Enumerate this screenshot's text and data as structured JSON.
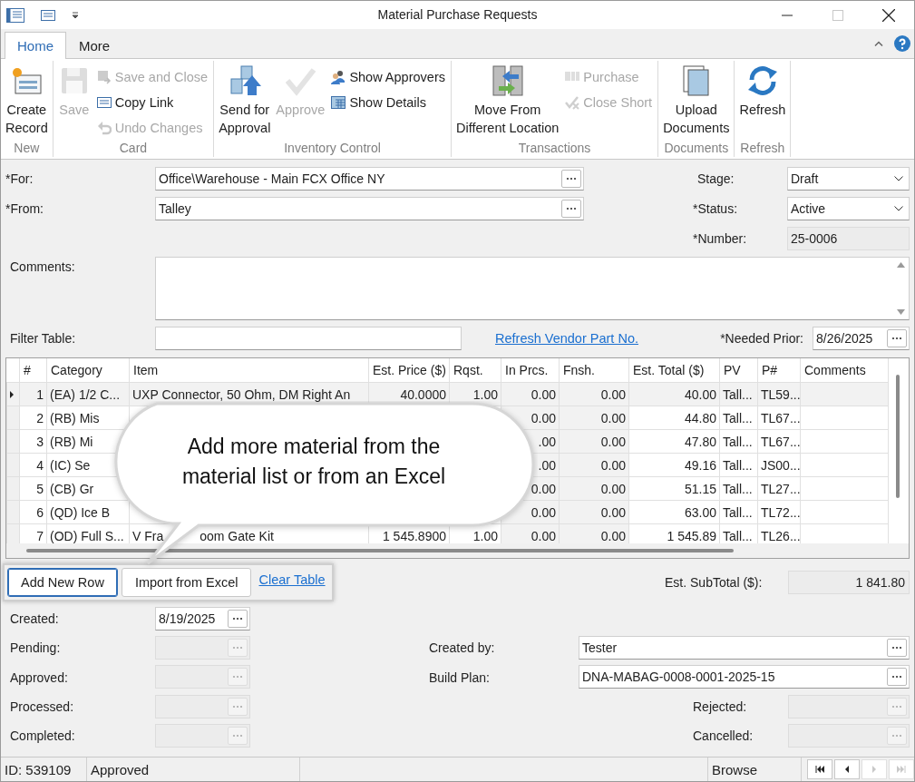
{
  "window": {
    "title": "Material Purchase Requests"
  },
  "tabs": [
    {
      "label": "Home",
      "selected": true
    },
    {
      "label": "More",
      "selected": false
    }
  ],
  "ribbon": [
    {
      "label": "New",
      "large": [
        {
          "kind": "create",
          "label": "Create\nRecord",
          "disabled": false
        }
      ]
    },
    {
      "label": "Card",
      "large": [
        {
          "kind": "save",
          "label": "Save",
          "disabled": true
        }
      ],
      "small": [
        {
          "kind": "saveclose",
          "label": "Save and Close",
          "disabled": true
        },
        {
          "kind": "copylink",
          "label": "Copy Link",
          "disabled": false
        },
        {
          "kind": "undo",
          "label": "Undo Changes",
          "disabled": true
        }
      ]
    },
    {
      "label": "Inventory Control",
      "large": [
        {
          "kind": "send",
          "label": "Send for\nApproval",
          "disabled": false
        },
        {
          "kind": "approve",
          "label": "Approve",
          "disabled": true
        }
      ],
      "small": [
        {
          "kind": "approvers",
          "label": "Show Approvers",
          "disabled": false
        },
        {
          "kind": "details",
          "label": "Show Details",
          "disabled": false
        }
      ]
    },
    {
      "label": "Transactions",
      "large": [
        {
          "kind": "move",
          "label": "Move From\nDifferent Location",
          "disabled": false
        }
      ],
      "small": [
        {
          "kind": "purchase",
          "label": "Purchase",
          "disabled": true
        },
        {
          "kind": "closeshort",
          "label": "Close Short",
          "disabled": true
        }
      ]
    },
    {
      "label": "Documents",
      "large": [
        {
          "kind": "upload",
          "label": "Upload\nDocuments",
          "disabled": false
        }
      ]
    },
    {
      "label": "Refresh",
      "large": [
        {
          "kind": "refresh",
          "label": "Refresh",
          "disabled": false
        }
      ]
    }
  ],
  "form": {
    "for": {
      "label": "*For:",
      "value": "Office\\Warehouse - Main FCX Office NY"
    },
    "from": {
      "label": "*From:",
      "value": "Talley"
    },
    "stage": {
      "label": "Stage:",
      "value": "Draft"
    },
    "status": {
      "label": "*Status:",
      "value": "Active"
    },
    "number": {
      "label": "*Number:",
      "value": "25-0006"
    },
    "comments": {
      "label": "Comments:"
    },
    "filter": {
      "label": "Filter Table:"
    },
    "refresh_link": "Refresh Vendor Part No.",
    "needed_prior": {
      "label": "*Needed Prior:",
      "value": "8/26/2025"
    }
  },
  "table": {
    "columns": [
      {
        "label": "#",
        "kind": "number",
        "readonly": false
      },
      {
        "label": "Category",
        "kind": "text",
        "readonly": false
      },
      {
        "label": "Item",
        "kind": "text",
        "readonly": false
      },
      {
        "label": "Est. Price ($)",
        "kind": "number",
        "readonly": false
      },
      {
        "label": "Rqst.",
        "kind": "number",
        "readonly": false
      },
      {
        "label": "In Prcs.",
        "kind": "number",
        "readonly": true
      },
      {
        "label": "Fnsh.",
        "kind": "number",
        "readonly": true
      },
      {
        "label": "Est. Total ($)",
        "kind": "number",
        "readonly": false
      },
      {
        "label": "PV",
        "kind": "text",
        "readonly": false
      },
      {
        "label": "P#",
        "kind": "text",
        "readonly": false
      },
      {
        "label": "Comments",
        "kind": "text",
        "readonly": false
      }
    ],
    "rows": [
      {
        "selected": true,
        "cells": [
          "1",
          "(EA) 1/2 C...",
          "UXP Connector, 50 Ohm, DM Right An",
          "40.0000",
          "1.00",
          "0.00",
          "0.00",
          "40.00",
          "Tall...",
          "TL59..."
        ]
      },
      {
        "selected": false,
        "cells": [
          "2",
          "(RB) Mis",
          null,
          null,
          null,
          "0.00",
          "0.00",
          "44.80",
          "Tall...",
          "TL67..."
        ]
      },
      {
        "selected": false,
        "cells": [
          "3",
          "(RB) Mi",
          null,
          null,
          null,
          ".00",
          "0.00",
          "47.80",
          "Tall...",
          "TL67..."
        ]
      },
      {
        "selected": false,
        "cells": [
          "4",
          "(IC) Se",
          null,
          null,
          null,
          ".00",
          "0.00",
          "49.16",
          "Tall...",
          "JS00..."
        ]
      },
      {
        "selected": false,
        "cells": [
          "5",
          "(CB) Gr",
          null,
          null,
          null,
          "0.00",
          "0.00",
          "51.15",
          "Tall...",
          "TL27..."
        ]
      },
      {
        "selected": false,
        "cells": [
          "6",
          "(QD) Ice B",
          null,
          null,
          null,
          "0.00",
          "0.00",
          "63.00",
          "Tall...",
          "TL72..."
        ]
      },
      {
        "selected": false,
        "cells": [
          "7",
          "(OD) Full S...",
          [
            "V Fra",
            "oom Gate Kit"
          ],
          "1 545.8900",
          "1.00",
          "0.00",
          "0.00",
          "1 545.89",
          "Tall...",
          "TL26..."
        ]
      }
    ]
  },
  "callout": {
    "text": "Add more material from the\nmaterial list or from an Excel"
  },
  "actions": [
    {
      "kind": "button",
      "label": "Add New Row",
      "focused": true
    },
    {
      "kind": "button",
      "label": "Import from Excel",
      "focused": false
    },
    {
      "kind": "link",
      "label": "Clear Table"
    }
  ],
  "subtotal": {
    "label": "Est. SubTotal ($):",
    "value": "1 841.80"
  },
  "dates": [
    {
      "label": "Created:",
      "value": "8/19/2025",
      "disabled": false
    },
    {
      "label": "Pending:",
      "disabled": true
    },
    {
      "label": "Approved:",
      "disabled": true
    },
    {
      "label": "Processed:",
      "disabled": true
    },
    {
      "label": "Completed:",
      "disabled": true
    }
  ],
  "created_by": {
    "label": "Created by:",
    "value": "Tester"
  },
  "build_plan": {
    "label": "Build Plan:",
    "value": "DNA-MABAG-0008-0001-2025-15"
  },
  "rejected": {
    "label": "Rejected:",
    "disabled": true
  },
  "cancelled": {
    "label": "Cancelled:",
    "disabled": true
  },
  "status_bar": {
    "id": "ID: 539109",
    "state": "Approved",
    "mode": "Browse",
    "nav": [
      {
        "kind": "first",
        "disabled": false
      },
      {
        "kind": "prev",
        "disabled": false
      },
      {
        "kind": "next",
        "disabled": true
      },
      {
        "kind": "last",
        "disabled": true
      }
    ]
  }
}
